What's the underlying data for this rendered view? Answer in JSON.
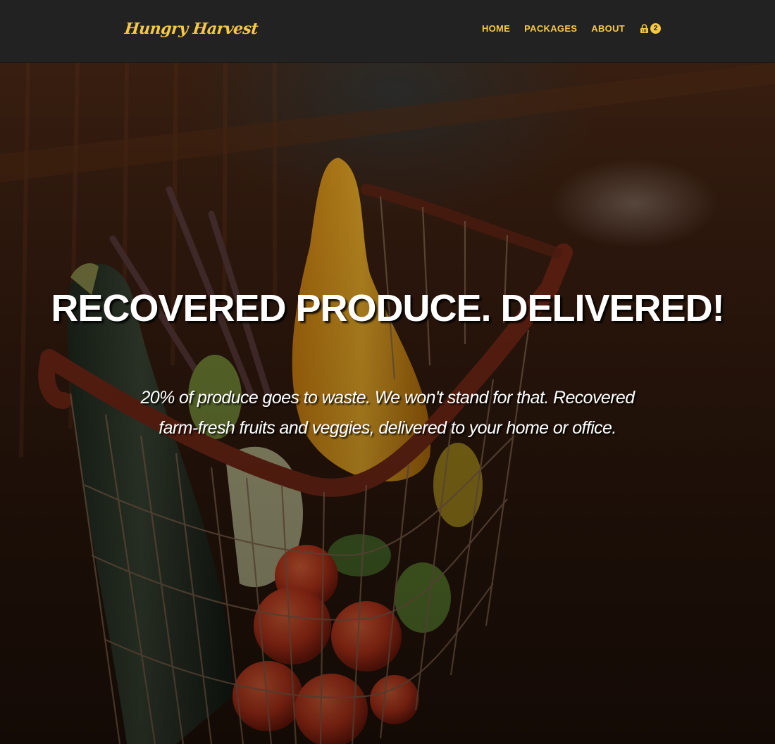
{
  "brand": {
    "name": "Hungry Harvest",
    "color": "#f7c843"
  },
  "nav": {
    "links": [
      {
        "label": "HOME"
      },
      {
        "label": "PACKAGES"
      },
      {
        "label": "ABOUT"
      }
    ],
    "cart": {
      "icon": "shopping-basket-icon",
      "count": "2"
    }
  },
  "hero": {
    "title": "RECOVERED PRODUCE. DELIVERED!",
    "subtitle": "20% of produce goes to waste. We won't stand for that. Recovered farm-fresh fruits and veggies, delivered to your home or office.",
    "background": "produce-basket-photo"
  },
  "colors": {
    "navbar": "#222222",
    "accent": "#f7c843",
    "hero_text": "#ffffff"
  }
}
